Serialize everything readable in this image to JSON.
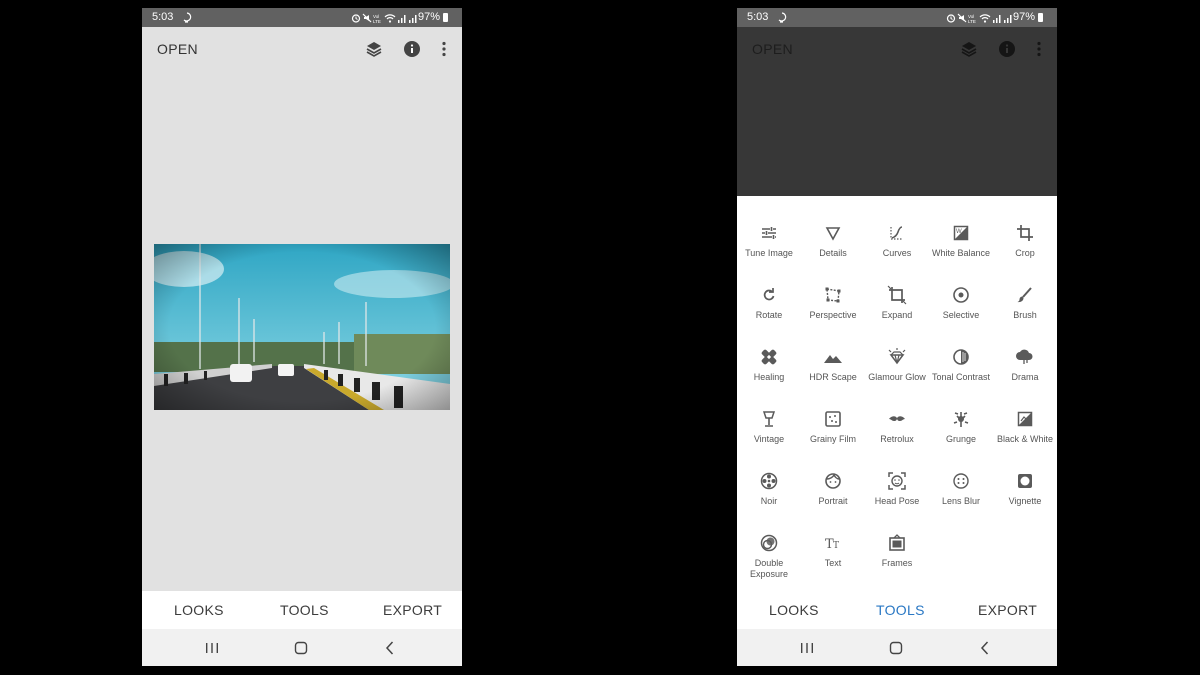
{
  "status_bar": {
    "time": "5:03",
    "battery": "97%"
  },
  "toolbar": {
    "open_label": "OPEN"
  },
  "bottom_nav": {
    "looks": "LOOKS",
    "tools": "TOOLS",
    "export": "EXPORT"
  },
  "colors": {
    "accent": "#2a78c4",
    "status_bar": "#616161",
    "canvas_light": "#e1e1e1",
    "canvas_dark": "#373737"
  },
  "icons": {
    "layers": "layers-icon",
    "info": "info-icon",
    "menu": "more-vert-icon",
    "recents": "recents-icon",
    "home": "home-icon",
    "back": "back-icon"
  },
  "tools": [
    {
      "label": "Tune Image",
      "icon": "tune-image-icon"
    },
    {
      "label": "Details",
      "icon": "details-icon"
    },
    {
      "label": "Curves",
      "icon": "curves-icon"
    },
    {
      "label": "White Balance",
      "icon": "white-balance-icon"
    },
    {
      "label": "Crop",
      "icon": "crop-icon"
    },
    {
      "label": "Rotate",
      "icon": "rotate-icon"
    },
    {
      "label": "Perspective",
      "icon": "perspective-icon"
    },
    {
      "label": "Expand",
      "icon": "expand-icon"
    },
    {
      "label": "Selective",
      "icon": "selective-icon"
    },
    {
      "label": "Brush",
      "icon": "brush-icon"
    },
    {
      "label": "Healing",
      "icon": "healing-icon"
    },
    {
      "label": "HDR Scape",
      "icon": "hdr-scape-icon"
    },
    {
      "label": "Glamour Glow",
      "icon": "glamour-glow-icon"
    },
    {
      "label": "Tonal Contrast",
      "icon": "tonal-contrast-icon"
    },
    {
      "label": "Drama",
      "icon": "drama-icon"
    },
    {
      "label": "Vintage",
      "icon": "vintage-icon"
    },
    {
      "label": "Grainy Film",
      "icon": "grainy-film-icon"
    },
    {
      "label": "Retrolux",
      "icon": "retrolux-icon"
    },
    {
      "label": "Grunge",
      "icon": "grunge-icon"
    },
    {
      "label": "Black & White",
      "icon": "black-white-icon"
    },
    {
      "label": "Noir",
      "icon": "noir-icon"
    },
    {
      "label": "Portrait",
      "icon": "portrait-icon"
    },
    {
      "label": "Head Pose",
      "icon": "head-pose-icon"
    },
    {
      "label": "Lens Blur",
      "icon": "lens-blur-icon"
    },
    {
      "label": "Vignette",
      "icon": "vignette-icon"
    },
    {
      "label": "Double Exposure",
      "icon": "double-exposure-icon"
    },
    {
      "label": "Text",
      "icon": "text-icon"
    },
    {
      "label": "Frames",
      "icon": "frames-icon"
    }
  ]
}
